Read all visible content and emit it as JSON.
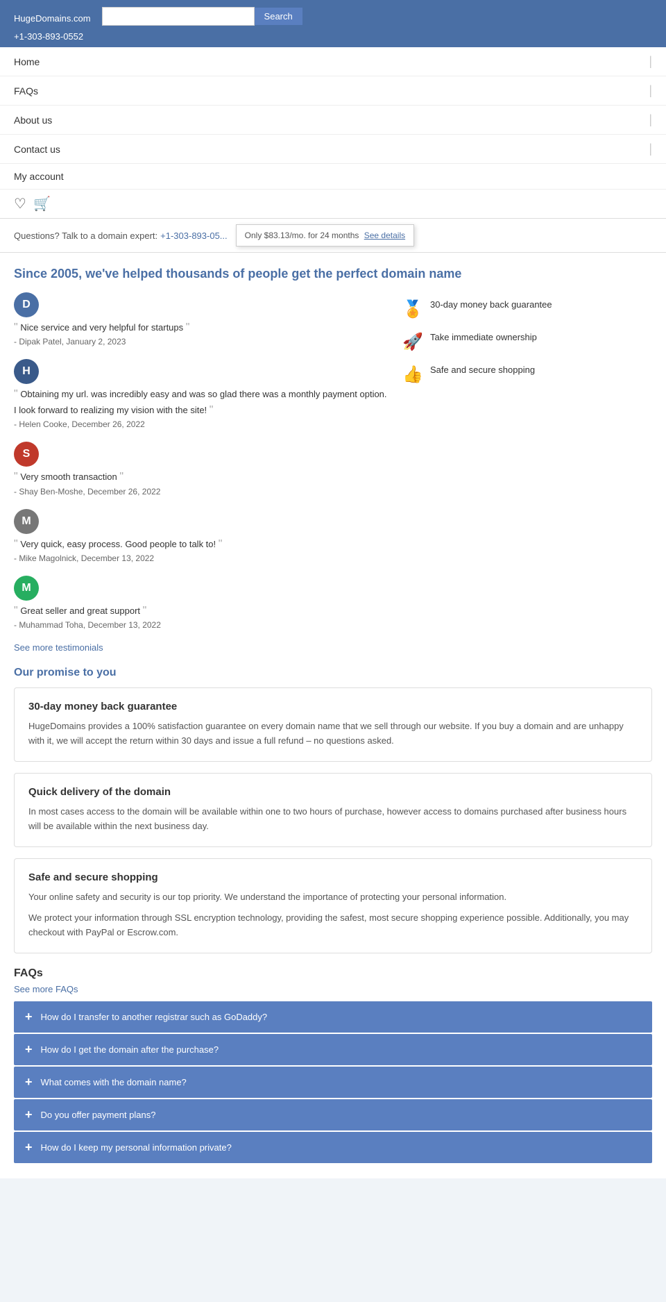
{
  "header": {
    "logo": "HugeDomains",
    "logo_suffix": ".com",
    "search_placeholder": "",
    "search_button": "Search",
    "phone": "+1-303-893-0552"
  },
  "nav": {
    "items": [
      {
        "label": "Home"
      },
      {
        "label": "FAQs"
      },
      {
        "label": "About us"
      },
      {
        "label": "Contact us"
      },
      {
        "label": "My account"
      }
    ]
  },
  "tooltip": {
    "question_text": "Questions? Talk to a domain expert:",
    "phone": "+1-303-893-05...",
    "popup_text": "Only $83.13/mo. for 24 months",
    "popup_link": "See details"
  },
  "section_title": "Since 2005, we've helped thousands of people get the perfect domain name",
  "testimonials": [
    {
      "initial": "D",
      "avatar_color": "blue",
      "quote": "Nice service and very helpful for startups",
      "author": "Dipak Patel, January 2, 2023"
    },
    {
      "initial": "H",
      "avatar_color": "blue2",
      "quote": "Obtaining my url. was incredibly easy and was so glad there was a monthly payment option. I look forward to realizing my vision with the site!",
      "author": "Helen Cooke, December 26, 2022"
    },
    {
      "initial": "S",
      "avatar_color": "red",
      "quote": "Very smooth transaction",
      "author": "Shay Ben-Moshe, December 26, 2022"
    },
    {
      "initial": "M",
      "avatar_color": "gray",
      "quote": "Very quick, easy process. Good people to talk to!",
      "author": "Mike Magolnick, December 13, 2022"
    },
    {
      "initial": "M",
      "avatar_color": "green",
      "quote": "Great seller and great support",
      "author": "Muhammad Toha, December 13, 2022"
    }
  ],
  "see_more_testimonials": "See more testimonials",
  "features": [
    {
      "icon": "🏅",
      "text": "30-day money back guarantee"
    },
    {
      "icon": "🚀",
      "text": "Take immediate ownership"
    },
    {
      "icon": "👍",
      "text": "Safe and secure shopping"
    }
  ],
  "promise_section": {
    "title": "Our promise to you",
    "cards": [
      {
        "title": "30-day money back guarantee",
        "text": "HugeDomains provides a 100% satisfaction guarantee on every domain name that we sell through our website. If you buy a domain and are unhappy with it, we will accept the return within 30 days and issue a full refund – no questions asked."
      },
      {
        "title": "Quick delivery of the domain",
        "text": "In most cases access to the domain will be available within one to two hours of purchase, however access to domains purchased after business hours will be available within the next business day."
      },
      {
        "title": "Safe and secure shopping",
        "text1": "Your online safety and security is our top priority. We understand the importance of protecting your personal information.",
        "text2": "We protect your information through SSL encryption technology, providing the safest, most secure shopping experience possible. Additionally, you may checkout with PayPal or Escrow.com."
      }
    ]
  },
  "faqs_section": {
    "title": "FAQs",
    "see_more": "See more FAQs",
    "items": [
      {
        "label": "How do I transfer to another registrar such as GoDaddy?"
      },
      {
        "label": "How do I get the domain after the purchase?"
      },
      {
        "label": "What comes with the domain name?"
      },
      {
        "label": "Do you offer payment plans?"
      },
      {
        "label": "How do I keep my personal information private?"
      }
    ]
  }
}
